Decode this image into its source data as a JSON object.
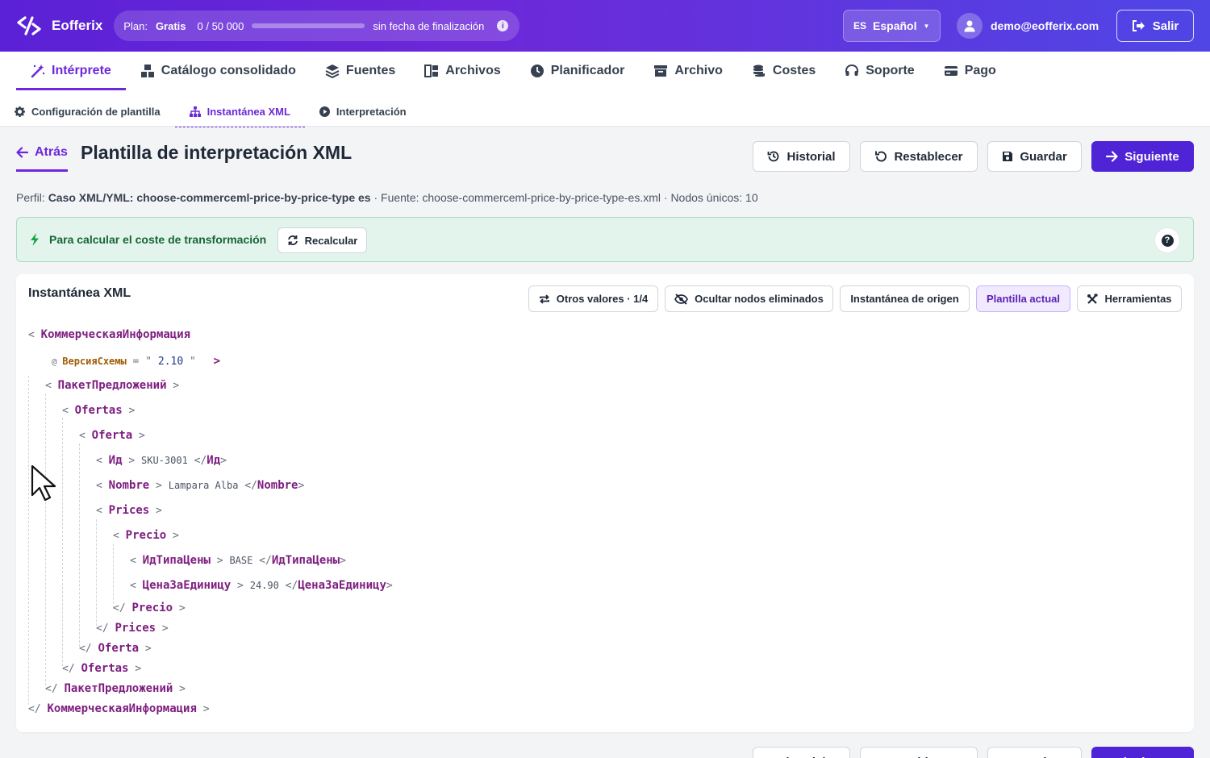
{
  "topbar": {
    "brand": "Eofferix",
    "plan_label": "Plan:",
    "plan_name": "Gratis",
    "plan_usage": "0 / 50 000",
    "plan_usage_fraction": 0,
    "plan_end": "sin fecha de finalización",
    "lang_code": "ES",
    "lang_name": "Español",
    "user_email": "demo@eofferix.com",
    "logout_label": "Salir"
  },
  "nav": {
    "tabs": [
      {
        "label": "Intérprete",
        "icon": "magic-wand-icon",
        "active": true
      },
      {
        "label": "Catálogo consolidado",
        "icon": "cubes-icon"
      },
      {
        "label": "Fuentes",
        "icon": "layers-icon"
      },
      {
        "label": "Archivos",
        "icon": "columns-icon"
      },
      {
        "label": "Planificador",
        "icon": "clock-icon"
      },
      {
        "label": "Archivo",
        "icon": "archive-icon"
      },
      {
        "label": "Costes",
        "icon": "coins-icon"
      },
      {
        "label": "Soporte",
        "icon": "headset-icon"
      },
      {
        "label": "Pago",
        "icon": "credit-card-icon"
      }
    ],
    "subtabs": [
      {
        "label": "Configuración de plantilla",
        "icon": "gear-icon"
      },
      {
        "label": "Instantánea XML",
        "icon": "sitemap-icon",
        "active": true
      },
      {
        "label": "Interpretación",
        "icon": "play-circle-icon"
      }
    ]
  },
  "header": {
    "back_label": "Atrás",
    "title": "Plantilla de interpretación XML",
    "history_label": "Historial",
    "reset_label": "Restablecer",
    "save_label": "Guardar",
    "next_label": "Siguiente"
  },
  "profile": {
    "profile_prefix": "Perfil:",
    "profile_name": "Caso XML/YML: choose-commerceml-price-by-price-type es",
    "source_text": "· Fuente: choose-commerceml-price-by-price-type-es.xml · Nodos únicos: 10"
  },
  "banner": {
    "text": "Para calcular el coste de transformación",
    "recalc_label": "Recalcular",
    "help": "?"
  },
  "panel": {
    "title": "Instantánea XML",
    "other_values_label": "Otros valores · 1/4",
    "hide_removed_label": "Ocultar nodos eliminados",
    "source_snapshot_label": "Instantánea de origen",
    "current_template_label": "Plantilla actual",
    "tools_label": "Herramientas"
  },
  "xml": {
    "root": "КоммерческаяИнформация",
    "root_attr_name": "ВерсияСхемы",
    "root_attr_value": "2.10",
    "n1": "ПакетПредложений",
    "n2": "Ofertas",
    "n3": "Oferta",
    "id_tag": "Ид",
    "id_val": "SKU-3001",
    "name_tag": "Nombre",
    "name_val": "Lampara Alba",
    "prices_tag": "Prices",
    "precio_tag": "Precio",
    "type_tag": "ИдТипаЦены",
    "type_val": "BASE",
    "unit_tag": "ЦенаЗаЕдиницу",
    "unit_val": "24.90"
  }
}
